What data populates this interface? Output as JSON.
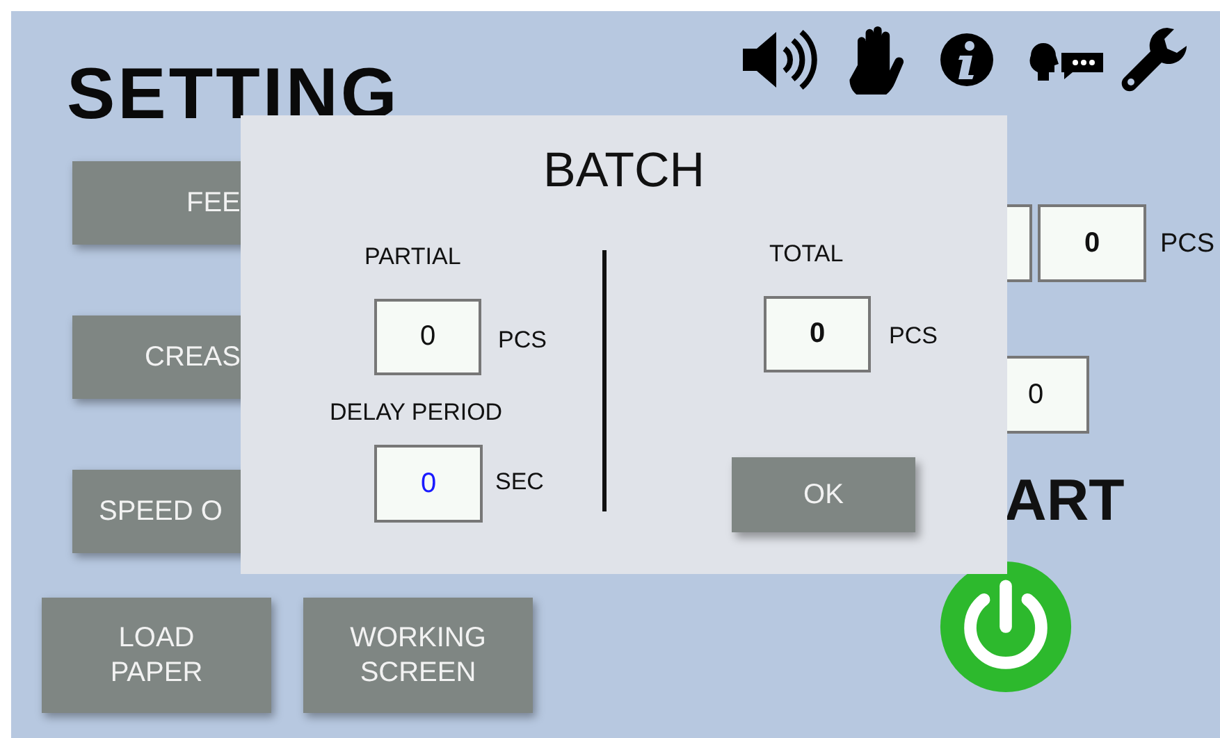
{
  "screen": {
    "title": "SETTING",
    "side_buttons": [
      {
        "label": "FEE"
      },
      {
        "label": "CREAS"
      },
      {
        "label": "SPEED O"
      }
    ],
    "bottom_buttons": [
      {
        "label": "LOAD\nPAPER"
      },
      {
        "label": "WORKING\nSCREEN"
      }
    ],
    "right_counter": {
      "value": "0",
      "unit": "PCS"
    },
    "right_field": {
      "value": "0"
    },
    "start_label": "ART"
  },
  "dialog": {
    "title": "BATCH",
    "partial": {
      "label": "PARTIAL",
      "value": "0",
      "unit": "PCS"
    },
    "delay": {
      "label": "DELAY PERIOD",
      "value": "0",
      "unit": "SEC"
    },
    "total": {
      "label": "TOTAL",
      "value": "0",
      "unit": "PCS"
    },
    "ok": "OK"
  }
}
